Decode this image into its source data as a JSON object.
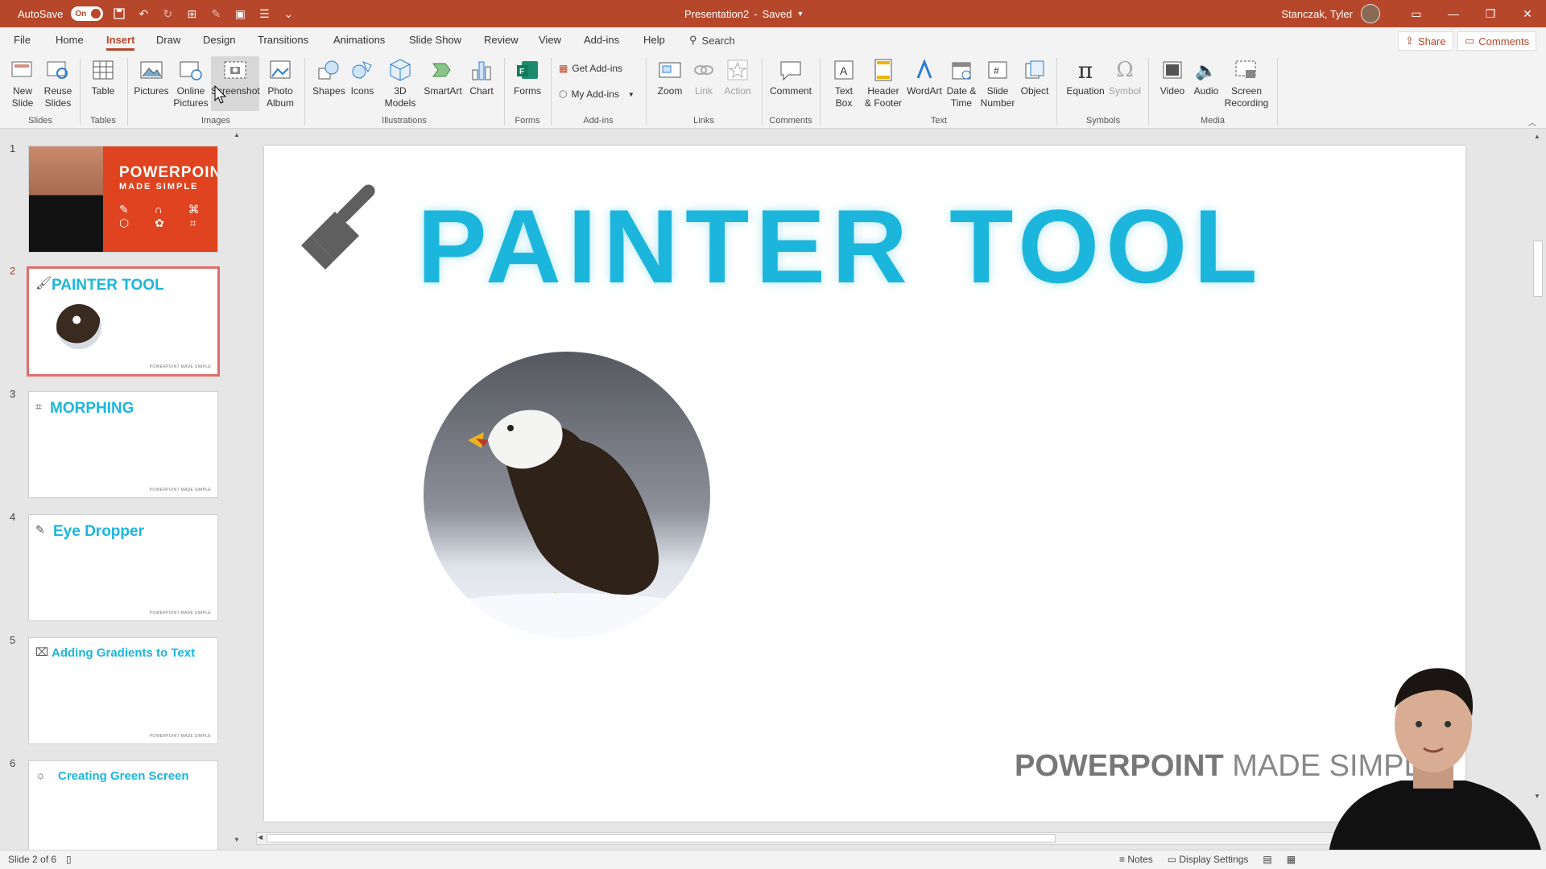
{
  "titlebar": {
    "autosave_label": "AutoSave",
    "autosave_state": "On",
    "doc_title": "Presentation2",
    "doc_status": "Saved",
    "user_name": "Stanczak, Tyler"
  },
  "tabs": [
    "File",
    "Home",
    "Insert",
    "Draw",
    "Design",
    "Transitions",
    "Animations",
    "Slide Show",
    "Review",
    "View",
    "Add-ins",
    "Help"
  ],
  "active_tab": "Insert",
  "search_label": "Search",
  "share_label": "Share",
  "comments_label": "Comments",
  "ribbon": {
    "new_slide": "New Slide",
    "reuse_slides": "Reuse Slides",
    "table": "Table",
    "pictures": "Pictures",
    "online_pictures": "Online Pictures",
    "screenshot": "Screenshot",
    "photo_album": "Photo Album",
    "shapes": "Shapes",
    "icons": "Icons",
    "models_3d": "3D Models",
    "smartart": "SmartArt",
    "chart": "Chart",
    "forms": "Forms",
    "get_addins": "Get Add-ins",
    "my_addins": "My Add-ins",
    "zoom": "Zoom",
    "link": "Link",
    "action": "Action",
    "comment": "Comment",
    "text_box": "Text Box",
    "header_footer": "Header & Footer",
    "wordart": "WordArt",
    "date_time": "Date & Time",
    "slide_number": "Slide Number",
    "object": "Object",
    "equation": "Equation",
    "symbol": "Symbol",
    "video": "Video",
    "audio": "Audio",
    "screen_recording": "Screen Recording",
    "groups": {
      "slides": "Slides",
      "tables": "Tables",
      "images": "Images",
      "illustrations": "Illustrations",
      "forms": "Forms",
      "addins": "Add-ins",
      "links": "Links",
      "comments": "Comments",
      "text": "Text",
      "symbols": "Symbols",
      "media": "Media"
    }
  },
  "thumbnails": [
    {
      "num": "1",
      "title": "POWERPOINT",
      "subtitle": "MADE SIMPLE"
    },
    {
      "num": "2",
      "title": "PAINTER TOOL",
      "foot": "POWERPOINT MADE SIMPLE"
    },
    {
      "num": "3",
      "title": "MORPHING",
      "foot": "POWERPOINT MADE SIMPLE"
    },
    {
      "num": "4",
      "title": "Eye Dropper",
      "foot": "POWERPOINT MADE SIMPLE"
    },
    {
      "num": "5",
      "title": "Adding Gradients to Text",
      "foot": "POWERPOINT MADE SIMPLE"
    },
    {
      "num": "6",
      "title": "Creating Green Screen"
    }
  ],
  "slide": {
    "title": "PAINTER TOOL",
    "brand_bold": "POWERPOINT",
    "brand_light": "MADE SIMPL"
  },
  "status": {
    "slide_info": "Slide 2 of 6",
    "notes": "Notes",
    "display_settings": "Display Settings"
  },
  "colors": {
    "accent": "#b7472a",
    "title_cyan": "#1cb6dd"
  }
}
